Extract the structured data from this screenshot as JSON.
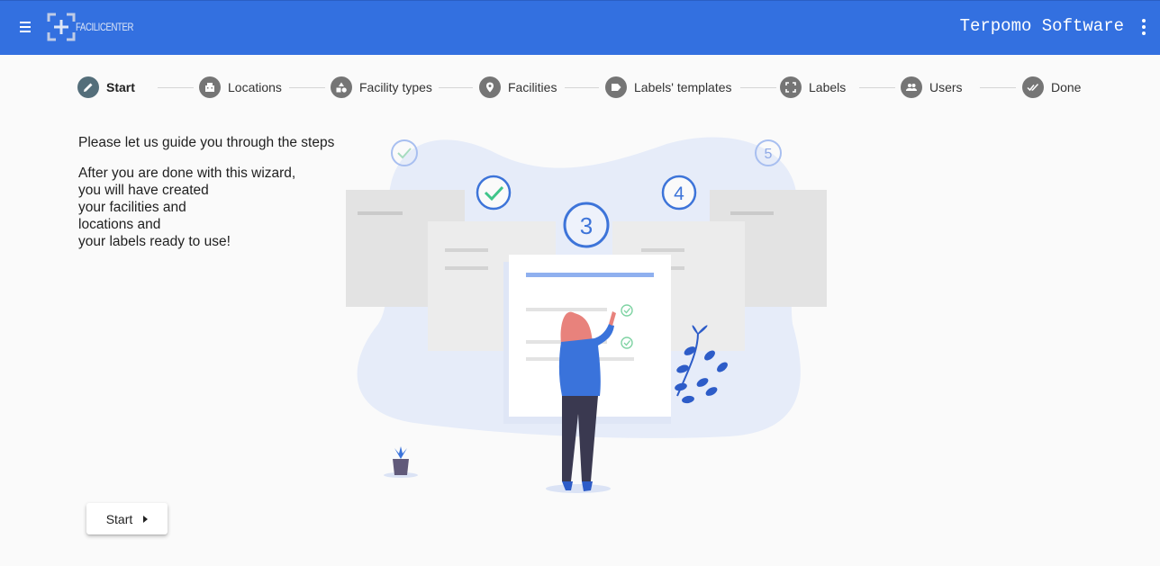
{
  "app": {
    "logo_text": "FACILICENTER",
    "company_name": "Terpomo Software",
    "accent_color": "#3370e0"
  },
  "stepper": {
    "steps": [
      {
        "label": "Start",
        "icon": "pencil-icon",
        "active": true
      },
      {
        "label": "Locations",
        "icon": "building-icon",
        "active": false
      },
      {
        "label": "Facility types",
        "icon": "shapes-icon",
        "active": false
      },
      {
        "label": "Facilities",
        "icon": "map-pin-icon",
        "active": false
      },
      {
        "label": "Labels' templates",
        "icon": "label-icon",
        "active": false
      },
      {
        "label": "Labels",
        "icon": "scan-frame-icon",
        "active": false
      },
      {
        "label": "Users",
        "icon": "people-icon",
        "active": false
      },
      {
        "label": "Done",
        "icon": "double-check-icon",
        "active": false
      }
    ]
  },
  "intro": {
    "heading": "Please let us guide you through the steps",
    "lines": [
      "After you are done with this wizard,",
      "you will have created",
      "your facilities and",
      "locations and",
      "your labels ready to use!"
    ]
  },
  "illustration": {
    "numbers": [
      "3",
      "4",
      "5"
    ]
  },
  "actions": {
    "start_label": "Start"
  }
}
